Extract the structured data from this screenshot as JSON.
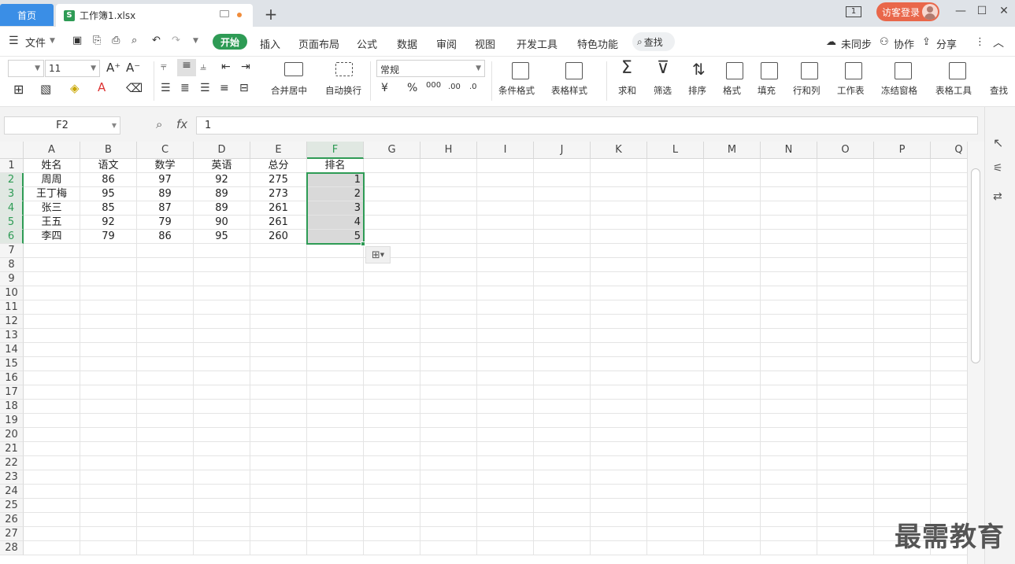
{
  "tabs": {
    "home": "首页",
    "doc": "工作簿1.xlsx",
    "new": "+"
  },
  "titlebar": {
    "window_badge": "1",
    "login": "访客登录",
    "minimize": "—",
    "restore": "☐",
    "close": "✕"
  },
  "menu": {
    "file": "文件",
    "items": [
      "开始",
      "插入",
      "页面布局",
      "公式",
      "数据",
      "审阅",
      "视图",
      "开发工具",
      "特色功能"
    ],
    "search": "查找",
    "right": [
      "未同步",
      "协作",
      "分享"
    ]
  },
  "ribbon": {
    "font_name": "",
    "font_size": "11",
    "number_format": "常规",
    "labels": {
      "merge": "合并居中",
      "wrap": "自动换行",
      "cond_format": "条件格式",
      "table_style": "表格样式",
      "sum": "求和",
      "filter": "筛选",
      "sort": "排序",
      "format": "格式",
      "fill": "填充",
      "rowcol": "行和列",
      "sheet": "工作表",
      "freeze": "冻结窗格",
      "tabletool": "表格工具",
      "find": "查找"
    },
    "currency": "¥",
    "percent": "%",
    "thousands": "000",
    "dec_inc": ".00",
    "dec_dec": ".0"
  },
  "formula_bar": {
    "cell_ref": "F2",
    "fx": "fx",
    "value": "1"
  },
  "sheet": {
    "columns": [
      "A",
      "B",
      "C",
      "D",
      "E",
      "F",
      "G",
      "H",
      "I",
      "J",
      "K",
      "L",
      "M",
      "N",
      "O",
      "P",
      "Q"
    ],
    "selected_column": "F",
    "row_numbers": [
      "1",
      "2",
      "3",
      "4",
      "5",
      "6",
      "7",
      "8",
      "9",
      "10",
      "11",
      "12",
      "13",
      "14",
      "15",
      "16",
      "17",
      "18",
      "19",
      "20",
      "21",
      "22",
      "23",
      "24",
      "25",
      "26",
      "27",
      "28"
    ],
    "rows": [
      [
        "姓名",
        "语文",
        "数学",
        "英语",
        "总分",
        "排名"
      ],
      [
        "周周",
        "86",
        "97",
        "92",
        "275",
        "1"
      ],
      [
        "王丁梅",
        "95",
        "89",
        "89",
        "273",
        "2"
      ],
      [
        "张三",
        "85",
        "87",
        "89",
        "261",
        "3"
      ],
      [
        "王五",
        "92",
        "79",
        "90",
        "261",
        "4"
      ],
      [
        "李四",
        "79",
        "86",
        "95",
        "260",
        "5"
      ]
    ]
  },
  "watermark": "最需教育",
  "colors": {
    "accent": "#2e9b55",
    "tab_blue": "#3a8ee6",
    "login_red": "#e9674a"
  }
}
